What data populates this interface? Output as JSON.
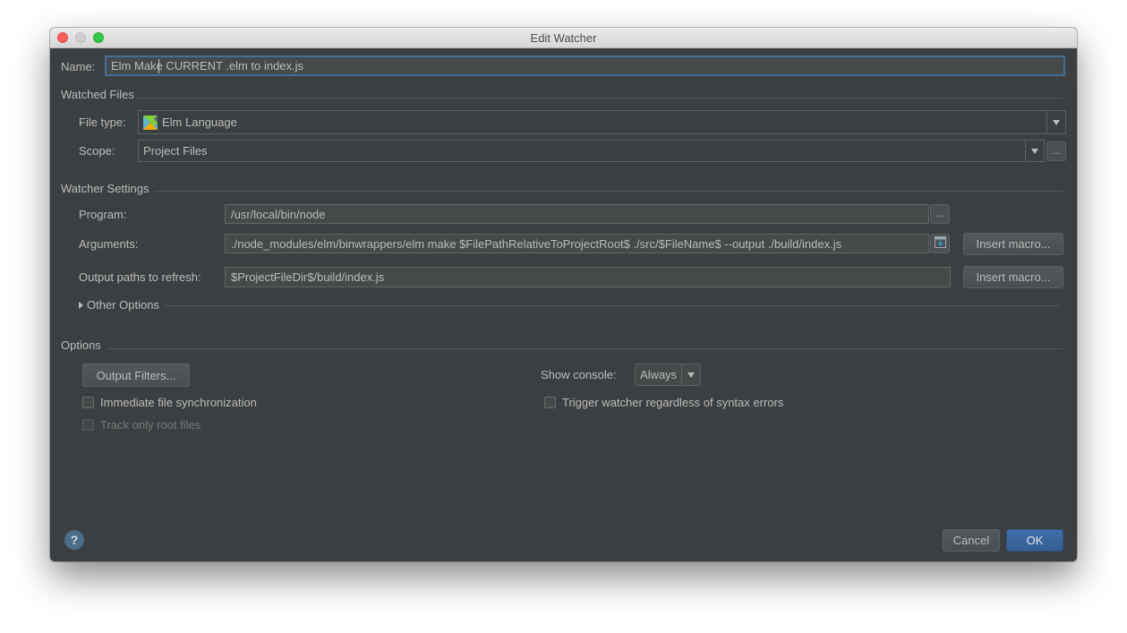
{
  "window": {
    "title": "Edit Watcher"
  },
  "name": {
    "label": "Name:",
    "value": "Elm Make CURRENT .elm to index.js"
  },
  "watched_files": {
    "section_label": "Watched Files",
    "file_type_label": "File type:",
    "file_type_value": "Elm Language",
    "file_type_icon": "elm-logo-icon",
    "scope_label": "Scope:",
    "scope_value": "Project Files",
    "scope_more": "..."
  },
  "watcher_settings": {
    "section_label": "Watcher Settings",
    "program_label": "Program:",
    "program_value": "/usr/local/bin/node",
    "program_more": "...",
    "arguments_label": "Arguments:",
    "arguments_value": "./node_modules/elm/binwrappers/elm make $FilePathRelativeToProjectRoot$ ./src/$FileName$ --output ./build/index.js",
    "insert_macro_1": "Insert macro...",
    "output_label": "Output paths to refresh:",
    "output_value": "$ProjectFileDir$/build/index.js",
    "insert_macro_2": "Insert macro...",
    "other_options": "Other Options"
  },
  "options": {
    "section_label": "Options",
    "output_filters_button": "Output Filters...",
    "show_console_label": "Show console:",
    "show_console_value": "Always",
    "immediate_sync_label": "Immediate file synchronization",
    "immediate_sync_checked": false,
    "trigger_watcher_label": "Trigger watcher regardless of syntax errors",
    "trigger_watcher_checked": false,
    "track_root_label": "Track only root files",
    "track_root_checked": false,
    "track_root_enabled": false
  },
  "footer": {
    "help_label": "?",
    "cancel_button": "Cancel",
    "ok_button": "OK"
  },
  "colors": {
    "dialog_bg": "#3c3f41",
    "field_bg": "#45494a",
    "focus_border": "#466d94",
    "primary_button": "#365f92"
  }
}
